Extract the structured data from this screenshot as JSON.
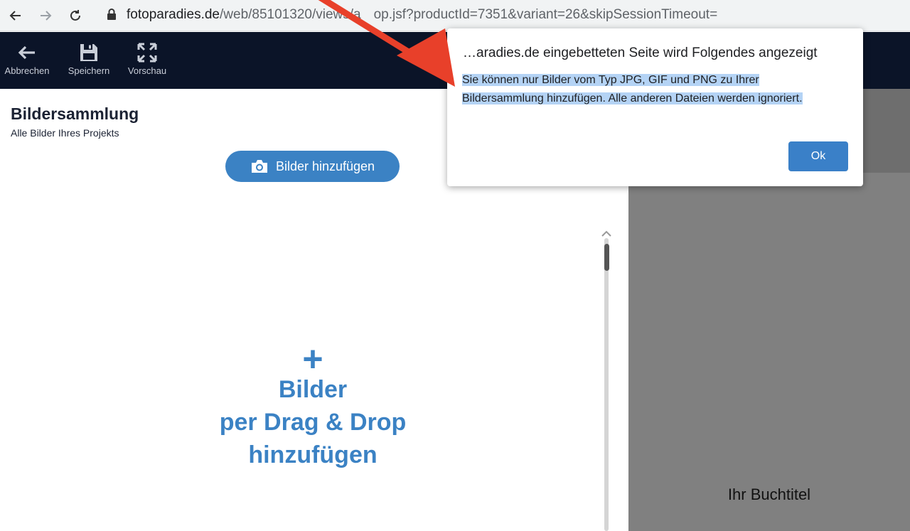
{
  "browser": {
    "url_domain": "fotoparadies.de",
    "url_path": "/web/85101320/views/a",
    "url_path_tail": "op.jsf?productId=7351&variant=26&skipSessionTimeout="
  },
  "toolbar": {
    "cancel_label": "Abbrechen",
    "save_label": "Speichern",
    "preview_label": "Vorschau"
  },
  "collection": {
    "title": "Bildersammlung",
    "subtitle": "Alle Bilder Ihres Projekts",
    "add_button_label": "Bilder hinzufügen",
    "drop_plus": "+",
    "drop_line1": "Bilder",
    "drop_line2": "per Drag & Drop",
    "drop_line3": "hinzufügen"
  },
  "preview": {
    "book_title": "Ihr Buchtitel"
  },
  "dialog": {
    "title": "…aradies.de eingebetteten Seite wird Folgendes angezeigt",
    "message_line1": "Sie können nur Bilder vom Typ JPG, GIF und PNG zu Ihrer",
    "message_line2": "Bildersammlung hinzufügen. Alle anderen Dateien werden ignoriert.",
    "ok_label": "Ok"
  },
  "colors": {
    "accent": "#3b82c4",
    "toolbar_bg": "#0b1428",
    "annotation_arrow": "#e8402a",
    "selection_highlight": "#b4d3f5"
  }
}
